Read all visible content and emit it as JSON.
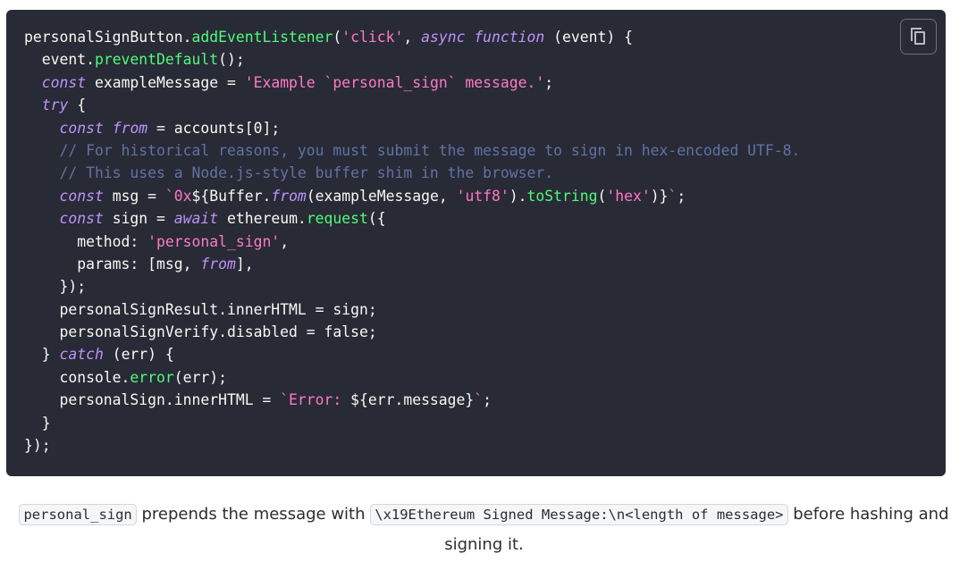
{
  "copy_button": {
    "icon": "copy-icon",
    "label": "Copy code"
  },
  "code": {
    "lines": [
      [
        {
          "t": "personalSignButton.",
          "c": "pl"
        },
        {
          "t": "addEventListener",
          "c": "fn"
        },
        {
          "t": "(",
          "c": "pl"
        },
        {
          "t": "'click'",
          "c": "str"
        },
        {
          "t": ", ",
          "c": "pl"
        },
        {
          "t": "async",
          "c": "kw"
        },
        {
          "t": " ",
          "c": "pl"
        },
        {
          "t": "function",
          "c": "kw"
        },
        {
          "t": " (event) {",
          "c": "pl"
        }
      ],
      [
        {
          "t": "  event.",
          "c": "pl"
        },
        {
          "t": "preventDefault",
          "c": "fn"
        },
        {
          "t": "();",
          "c": "pl"
        }
      ],
      [
        {
          "t": "  ",
          "c": "pl"
        },
        {
          "t": "const",
          "c": "kw"
        },
        {
          "t": " exampleMessage = ",
          "c": "pl"
        },
        {
          "t": "'Example `personal_sign` message.'",
          "c": "str"
        },
        {
          "t": ";",
          "c": "pl"
        }
      ],
      [
        {
          "t": "  ",
          "c": "pl"
        },
        {
          "t": "try",
          "c": "kw"
        },
        {
          "t": " {",
          "c": "pl"
        }
      ],
      [
        {
          "t": "    ",
          "c": "pl"
        },
        {
          "t": "const",
          "c": "kw"
        },
        {
          "t": " ",
          "c": "pl"
        },
        {
          "t": "from",
          "c": "kw"
        },
        {
          "t": " = accounts[0];",
          "c": "pl"
        }
      ],
      [
        {
          "t": "    // For historical reasons, you must submit the message to sign in hex-encoded UTF-8.",
          "c": "cm"
        }
      ],
      [
        {
          "t": "    // This uses a Node.js-style buffer shim in the browser.",
          "c": "cm"
        }
      ],
      [
        {
          "t": "    ",
          "c": "pl"
        },
        {
          "t": "const",
          "c": "kw"
        },
        {
          "t": " msg = ",
          "c": "pl"
        },
        {
          "t": "`0x",
          "c": "str"
        },
        {
          "t": "${Buffer.",
          "c": "pl"
        },
        {
          "t": "from",
          "c": "kw"
        },
        {
          "t": "(exampleMessage, ",
          "c": "pl"
        },
        {
          "t": "'utf8'",
          "c": "str"
        },
        {
          "t": ").",
          "c": "pl"
        },
        {
          "t": "toString",
          "c": "fn"
        },
        {
          "t": "(",
          "c": "pl"
        },
        {
          "t": "'hex'",
          "c": "str"
        },
        {
          "t": ")}",
          "c": "pl"
        },
        {
          "t": "`",
          "c": "str"
        },
        {
          "t": ";",
          "c": "pl"
        }
      ],
      [
        {
          "t": "    ",
          "c": "pl"
        },
        {
          "t": "const",
          "c": "kw"
        },
        {
          "t": " sign = ",
          "c": "pl"
        },
        {
          "t": "await",
          "c": "kw"
        },
        {
          "t": " ethereum.",
          "c": "pl"
        },
        {
          "t": "request",
          "c": "fn"
        },
        {
          "t": "({",
          "c": "pl"
        }
      ],
      [
        {
          "t": "      method: ",
          "c": "pl"
        },
        {
          "t": "'personal_sign'",
          "c": "str"
        },
        {
          "t": ",",
          "c": "pl"
        }
      ],
      [
        {
          "t": "      params: [msg, ",
          "c": "pl"
        },
        {
          "t": "from",
          "c": "kw"
        },
        {
          "t": "],",
          "c": "pl"
        }
      ],
      [
        {
          "t": "    });",
          "c": "pl"
        }
      ],
      [
        {
          "t": "    personalSignResult.innerHTML = sign;",
          "c": "pl"
        }
      ],
      [
        {
          "t": "    personalSignVerify.disabled = false;",
          "c": "pl"
        }
      ],
      [
        {
          "t": "  } ",
          "c": "pl"
        },
        {
          "t": "catch",
          "c": "kw"
        },
        {
          "t": " (err) {",
          "c": "pl"
        }
      ],
      [
        {
          "t": "    console.",
          "c": "pl"
        },
        {
          "t": "error",
          "c": "fn"
        },
        {
          "t": "(err);",
          "c": "pl"
        }
      ],
      [
        {
          "t": "    personalSign.innerHTML = ",
          "c": "pl"
        },
        {
          "t": "`Error: ",
          "c": "str"
        },
        {
          "t": "${err.message}",
          "c": "pl"
        },
        {
          "t": "`",
          "c": "str"
        },
        {
          "t": ";",
          "c": "pl"
        }
      ],
      [
        {
          "t": "  }",
          "c": "pl"
        }
      ],
      [
        {
          "t": "});",
          "c": "pl"
        }
      ]
    ]
  },
  "caption": {
    "code1": "personal_sign",
    "text1": " prepends the message with ",
    "code2": "\\x19Ethereum Signed Message:\\n<length of message>",
    "text2": " before hashing and signing it."
  }
}
